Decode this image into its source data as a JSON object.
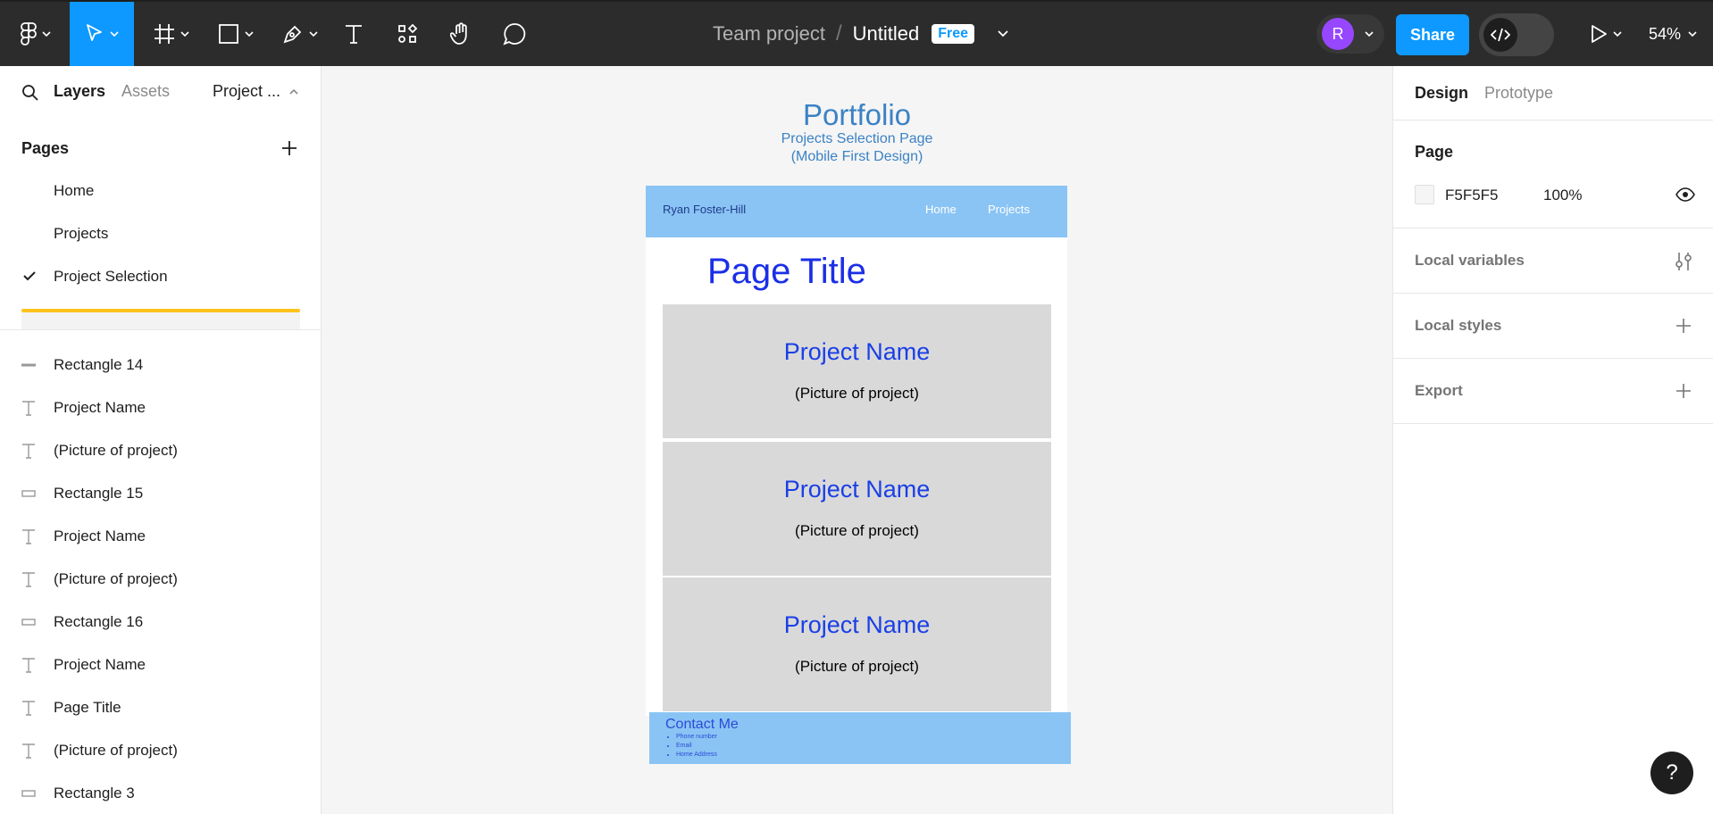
{
  "toolbar": {
    "team_name": "Team project",
    "separator": "/",
    "file_name": "Untitled",
    "plan_badge": "Free",
    "avatar_initial": "R",
    "share_label": "Share",
    "zoom": "54%"
  },
  "left_panel": {
    "tabs": {
      "layers": "Layers",
      "assets": "Assets",
      "page_switch": "Project ..."
    },
    "pages_title": "Pages",
    "pages": [
      {
        "name": "Home"
      },
      {
        "name": "Projects"
      },
      {
        "name": "Project Selection"
      }
    ],
    "layers": [
      {
        "name": "Rectangle 14",
        "type": "line"
      },
      {
        "name": "Project Name",
        "type": "text"
      },
      {
        "name": "(Picture of project)",
        "type": "text"
      },
      {
        "name": "Rectangle 15",
        "type": "rect"
      },
      {
        "name": "Project Name",
        "type": "text"
      },
      {
        "name": "(Picture of project)",
        "type": "text"
      },
      {
        "name": "Rectangle 16",
        "type": "rect"
      },
      {
        "name": "Project Name",
        "type": "text"
      },
      {
        "name": "Page Title",
        "type": "text"
      },
      {
        "name": "(Picture of project)",
        "type": "text"
      },
      {
        "name": "Rectangle 3",
        "type": "rect"
      }
    ]
  },
  "right_panel": {
    "tabs": {
      "design": "Design",
      "prototype": "Prototype"
    },
    "page_heading": "Page",
    "page_color": "F5F5F5",
    "page_opacity": "100%",
    "local_variables": "Local variables",
    "local_styles": "Local styles",
    "export": "Export"
  },
  "canvas": {
    "heading": "Portfolio",
    "subheading_1": "Projects Selection Page",
    "subheading_2": "(Mobile First Design)",
    "frame": {
      "site_name": "Ryan Foster-Hill",
      "nav": [
        "Home",
        "Projects"
      ],
      "page_title": "Page Title",
      "cards": [
        {
          "name": "Project Name",
          "picture": "(Picture of project)"
        },
        {
          "name": "Project Name",
          "picture": "(Picture of project)"
        },
        {
          "name": "Project Name",
          "picture": "(Picture of project)"
        }
      ],
      "contact_title": "Contact Me",
      "contact_items": [
        "Phone number",
        "Email",
        "Home Address"
      ]
    }
  },
  "help_label": "?",
  "colors": {
    "toolbar_bg": "#2c2c2c",
    "accent": "#0d99ff",
    "avatar": "#9747ff",
    "scroll_indicator": "#ffc21a",
    "frame_header": "#8ac4f4",
    "card_bg": "#d9d9d9",
    "page_title_blue": "#1a2fe6"
  }
}
